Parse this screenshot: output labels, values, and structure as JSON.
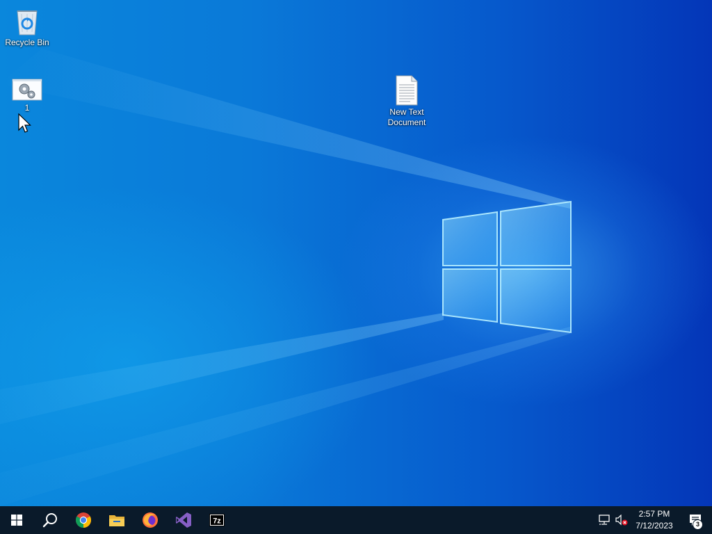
{
  "desktop": {
    "icons": [
      {
        "label": "Recycle Bin",
        "icon": "recycle-bin-icon"
      },
      {
        "label": "1",
        "icon": "settings-gear-window-icon"
      },
      {
        "label": "New Text Document",
        "icon": "text-document-icon"
      }
    ],
    "wallpaper": {
      "logo": "windows-logo",
      "accent": "#0a79d8",
      "edge": "#0436b8"
    }
  },
  "taskbar": {
    "background": "#0a1a2a",
    "buttons": [
      {
        "name": "start",
        "icon": "windows-start-icon"
      },
      {
        "name": "search",
        "icon": "search-icon"
      },
      {
        "name": "chrome",
        "icon": "chrome-icon"
      },
      {
        "name": "file-explorer",
        "icon": "folder-icon"
      },
      {
        "name": "firefox",
        "icon": "firefox-icon"
      },
      {
        "name": "visual-studio",
        "icon": "visual-studio-icon"
      },
      {
        "name": "7zip",
        "icon": "7zip-icon",
        "text": "7z"
      }
    ],
    "tray": {
      "network_icon": "network-disconnected-icon",
      "volume_icon": "volume-muted-icon",
      "time": "2:57 PM",
      "date": "7/12/2023",
      "notifications_icon": "action-center-icon",
      "notification_count": "3"
    }
  }
}
